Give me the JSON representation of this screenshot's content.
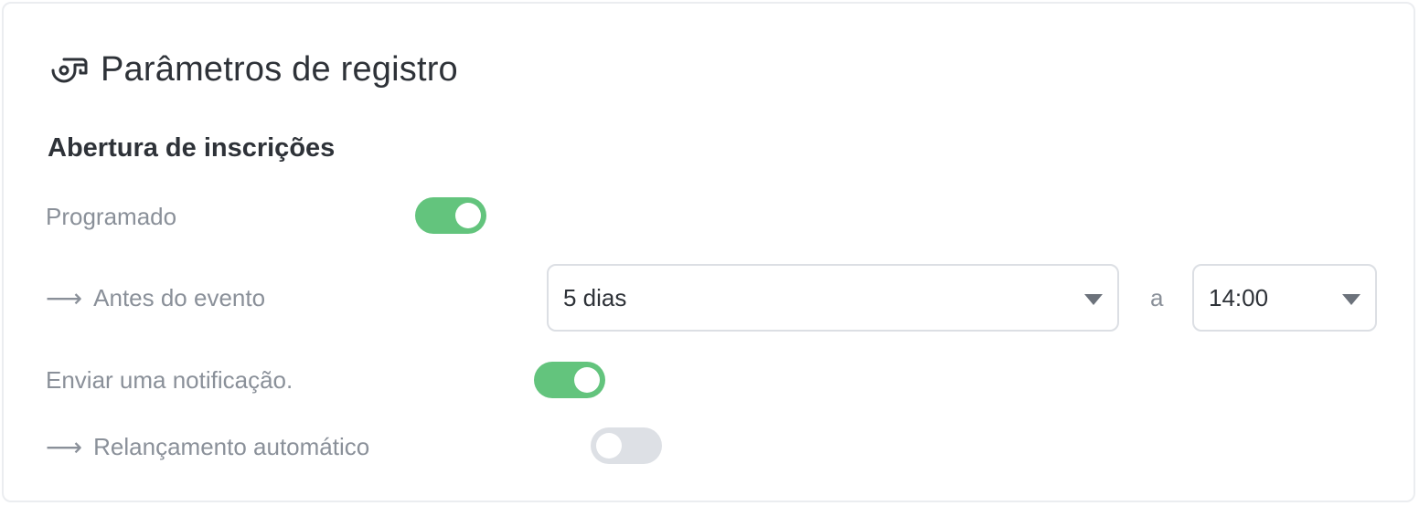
{
  "title": "Parâmetros de registro",
  "section_title": "Abertura de inscrições",
  "rows": {
    "programado": {
      "label": "Programado",
      "toggle_on": true
    },
    "antes": {
      "arrow": "⟶",
      "label": "Antes do evento",
      "days_value": "5 dias",
      "separator": "a",
      "time_value": "14:00"
    },
    "notificacao": {
      "label": "Enviar uma notificação.",
      "toggle_on": true
    },
    "relancamento": {
      "arrow": "⟶",
      "label": "Relançamento automático",
      "toggle_on": false
    }
  },
  "colors": {
    "toggle_on": "#63c47d",
    "toggle_off": "#dde0e5",
    "text_primary": "#2e3238",
    "text_muted": "#8a9099"
  },
  "icons": {
    "title": "whistle-icon",
    "dropdown": "caret-down-icon"
  }
}
